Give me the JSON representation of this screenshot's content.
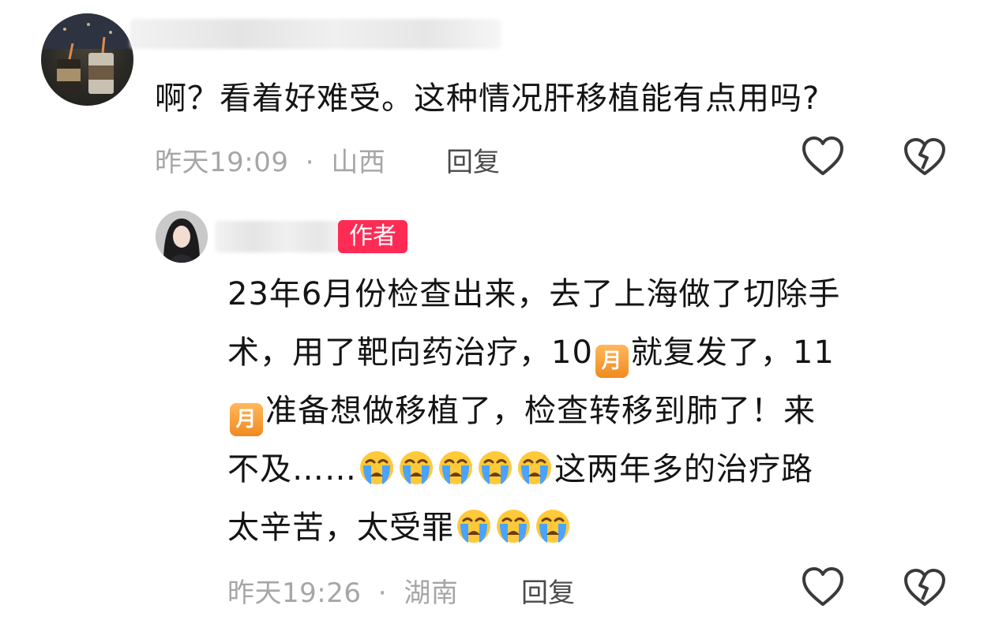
{
  "comment1": {
    "text": "啊？看着好难受。这种情况肝移植能有点用吗?",
    "time": "昨天19:09",
    "location": "山西",
    "reply_label": "回复"
  },
  "comment2": {
    "badge": "作者",
    "lines": [
      [
        "23年6月份检查出来，去了上海做了切除手"
      ],
      [
        "术，用了靶向药治疗，10",
        {
          "emoji": "month",
          "label": "月"
        },
        "就复发了，11"
      ],
      [
        {
          "emoji": "month",
          "label": "月"
        },
        "准备想做移植了，检查转移到肺了！来"
      ],
      [
        "不及……",
        {
          "emoji": "crying"
        },
        {
          "emoji": "crying"
        },
        {
          "emoji": "crying"
        },
        {
          "emoji": "crying"
        },
        {
          "emoji": "crying"
        },
        "这两年多的治疗路"
      ],
      [
        "太辛苦，太受罪",
        {
          "emoji": "crying"
        },
        {
          "emoji": "crying"
        },
        {
          "emoji": "crying"
        }
      ]
    ],
    "time": "昨天19:26",
    "location": "湖南",
    "reply_label": "回复"
  },
  "icons": {
    "like": "heart-outline-icon",
    "dislike": "broken-heart-icon"
  },
  "colors": {
    "badge": "#fe2c55",
    "meta": "#a6a6a6"
  }
}
